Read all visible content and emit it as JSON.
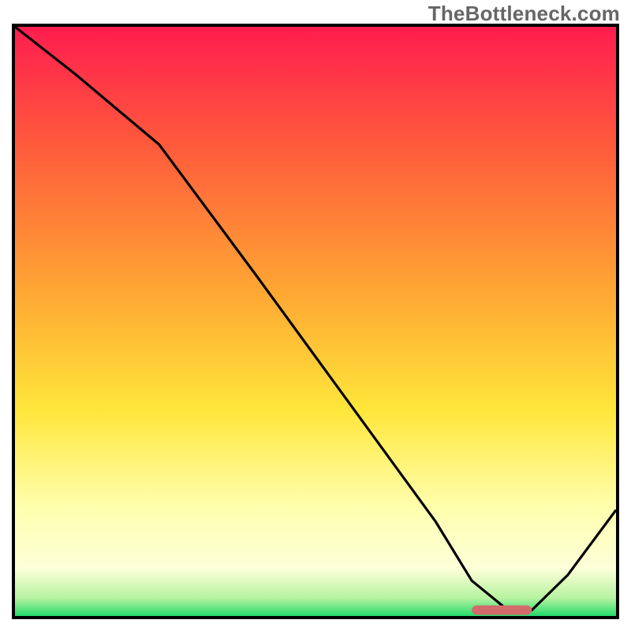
{
  "watermark": "TheBottleneck.com",
  "chart_data": {
    "type": "line",
    "title": "",
    "xlabel": "",
    "ylabel": "",
    "xlim": [
      0,
      100
    ],
    "ylim": [
      0,
      100
    ],
    "grid": false,
    "legend": false,
    "background_gradient": {
      "type": "vertical",
      "stops": [
        {
          "offset": 0.0,
          "color": "#ff1d4f"
        },
        {
          "offset": 0.2,
          "color": "#ff5a3c"
        },
        {
          "offset": 0.45,
          "color": "#ffa733"
        },
        {
          "offset": 0.65,
          "color": "#ffe63a"
        },
        {
          "offset": 0.82,
          "color": "#ffffb0"
        },
        {
          "offset": 0.92,
          "color": "#fcffd8"
        },
        {
          "offset": 0.97,
          "color": "#b6f2a0"
        },
        {
          "offset": 1.0,
          "color": "#22db6a"
        }
      ]
    },
    "series": [
      {
        "name": "bottleneck_curve",
        "x": [
          0,
          10,
          24,
          40,
          55,
          70,
          76,
          82,
          86,
          92,
          100
        ],
        "values": [
          100,
          92,
          80,
          58,
          37,
          16,
          6,
          1,
          1,
          7,
          18
        ]
      }
    ],
    "annotations": [
      {
        "name": "optimum_band",
        "shape": "rounded_rect",
        "x_start": 76,
        "x_end": 86,
        "y": 1,
        "color": "#d36a6c"
      }
    ]
  }
}
